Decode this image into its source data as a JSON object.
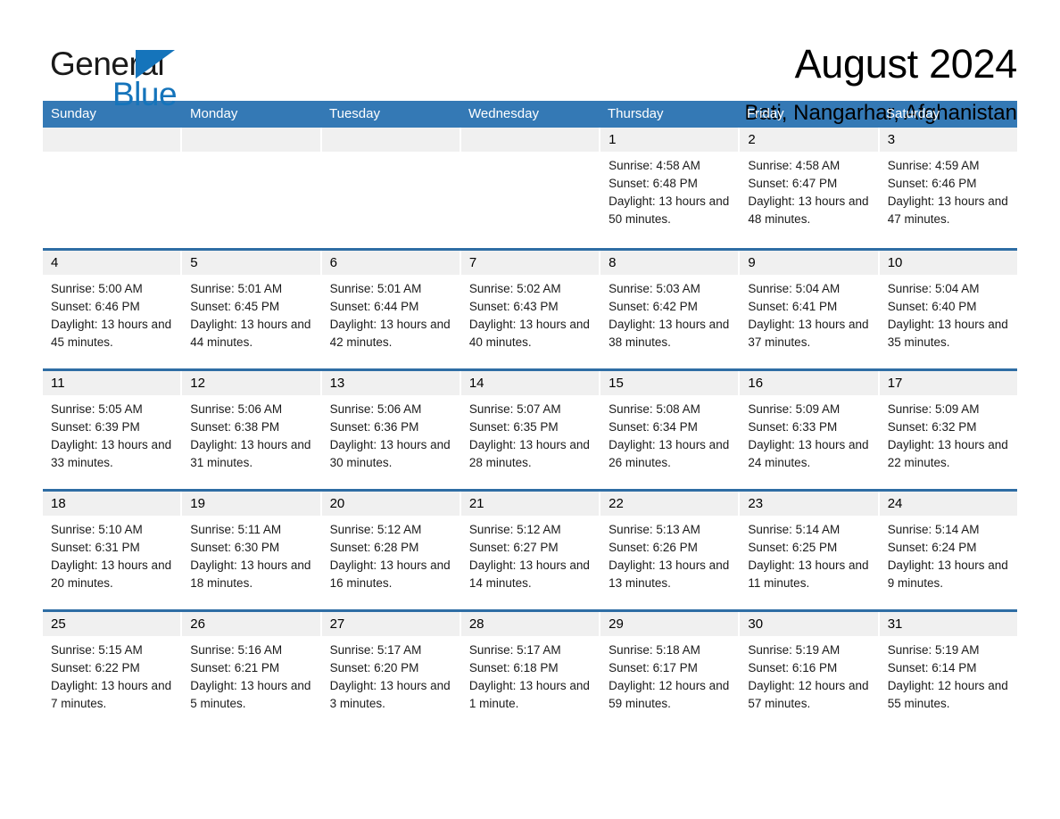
{
  "brand": {
    "name_top": "General",
    "name_bottom": "Blue",
    "triangle_color": "#1574bb"
  },
  "header": {
    "month_title": "August 2024",
    "location": "Bati, Nangarhar, Afghanistan"
  },
  "theme": {
    "header_blue": "#3479b5",
    "row_divider_blue": "#2e6da4",
    "day_number_band": "#f0f0f0"
  },
  "weekdays": [
    "Sunday",
    "Monday",
    "Tuesday",
    "Wednesday",
    "Thursday",
    "Friday",
    "Saturday"
  ],
  "weeks": [
    [
      {
        "day": "",
        "empty": true
      },
      {
        "day": "",
        "empty": true
      },
      {
        "day": "",
        "empty": true
      },
      {
        "day": "",
        "empty": true
      },
      {
        "day": "1",
        "sunrise": "Sunrise: 4:58 AM",
        "sunset": "Sunset: 6:48 PM",
        "daylight": "Daylight: 13 hours and 50 minutes."
      },
      {
        "day": "2",
        "sunrise": "Sunrise: 4:58 AM",
        "sunset": "Sunset: 6:47 PM",
        "daylight": "Daylight: 13 hours and 48 minutes."
      },
      {
        "day": "3",
        "sunrise": "Sunrise: 4:59 AM",
        "sunset": "Sunset: 6:46 PM",
        "daylight": "Daylight: 13 hours and 47 minutes."
      }
    ],
    [
      {
        "day": "4",
        "sunrise": "Sunrise: 5:00 AM",
        "sunset": "Sunset: 6:46 PM",
        "daylight": "Daylight: 13 hours and 45 minutes."
      },
      {
        "day": "5",
        "sunrise": "Sunrise: 5:01 AM",
        "sunset": "Sunset: 6:45 PM",
        "daylight": "Daylight: 13 hours and 44 minutes."
      },
      {
        "day": "6",
        "sunrise": "Sunrise: 5:01 AM",
        "sunset": "Sunset: 6:44 PM",
        "daylight": "Daylight: 13 hours and 42 minutes."
      },
      {
        "day": "7",
        "sunrise": "Sunrise: 5:02 AM",
        "sunset": "Sunset: 6:43 PM",
        "daylight": "Daylight: 13 hours and 40 minutes."
      },
      {
        "day": "8",
        "sunrise": "Sunrise: 5:03 AM",
        "sunset": "Sunset: 6:42 PM",
        "daylight": "Daylight: 13 hours and 38 minutes."
      },
      {
        "day": "9",
        "sunrise": "Sunrise: 5:04 AM",
        "sunset": "Sunset: 6:41 PM",
        "daylight": "Daylight: 13 hours and 37 minutes."
      },
      {
        "day": "10",
        "sunrise": "Sunrise: 5:04 AM",
        "sunset": "Sunset: 6:40 PM",
        "daylight": "Daylight: 13 hours and 35 minutes."
      }
    ],
    [
      {
        "day": "11",
        "sunrise": "Sunrise: 5:05 AM",
        "sunset": "Sunset: 6:39 PM",
        "daylight": "Daylight: 13 hours and 33 minutes."
      },
      {
        "day": "12",
        "sunrise": "Sunrise: 5:06 AM",
        "sunset": "Sunset: 6:38 PM",
        "daylight": "Daylight: 13 hours and 31 minutes."
      },
      {
        "day": "13",
        "sunrise": "Sunrise: 5:06 AM",
        "sunset": "Sunset: 6:36 PM",
        "daylight": "Daylight: 13 hours and 30 minutes."
      },
      {
        "day": "14",
        "sunrise": "Sunrise: 5:07 AM",
        "sunset": "Sunset: 6:35 PM",
        "daylight": "Daylight: 13 hours and 28 minutes."
      },
      {
        "day": "15",
        "sunrise": "Sunrise: 5:08 AM",
        "sunset": "Sunset: 6:34 PM",
        "daylight": "Daylight: 13 hours and 26 minutes."
      },
      {
        "day": "16",
        "sunrise": "Sunrise: 5:09 AM",
        "sunset": "Sunset: 6:33 PM",
        "daylight": "Daylight: 13 hours and 24 minutes."
      },
      {
        "day": "17",
        "sunrise": "Sunrise: 5:09 AM",
        "sunset": "Sunset: 6:32 PM",
        "daylight": "Daylight: 13 hours and 22 minutes."
      }
    ],
    [
      {
        "day": "18",
        "sunrise": "Sunrise: 5:10 AM",
        "sunset": "Sunset: 6:31 PM",
        "daylight": "Daylight: 13 hours and 20 minutes."
      },
      {
        "day": "19",
        "sunrise": "Sunrise: 5:11 AM",
        "sunset": "Sunset: 6:30 PM",
        "daylight": "Daylight: 13 hours and 18 minutes."
      },
      {
        "day": "20",
        "sunrise": "Sunrise: 5:12 AM",
        "sunset": "Sunset: 6:28 PM",
        "daylight": "Daylight: 13 hours and 16 minutes."
      },
      {
        "day": "21",
        "sunrise": "Sunrise: 5:12 AM",
        "sunset": "Sunset: 6:27 PM",
        "daylight": "Daylight: 13 hours and 14 minutes."
      },
      {
        "day": "22",
        "sunrise": "Sunrise: 5:13 AM",
        "sunset": "Sunset: 6:26 PM",
        "daylight": "Daylight: 13 hours and 13 minutes."
      },
      {
        "day": "23",
        "sunrise": "Sunrise: 5:14 AM",
        "sunset": "Sunset: 6:25 PM",
        "daylight": "Daylight: 13 hours and 11 minutes."
      },
      {
        "day": "24",
        "sunrise": "Sunrise: 5:14 AM",
        "sunset": "Sunset: 6:24 PM",
        "daylight": "Daylight: 13 hours and 9 minutes."
      }
    ],
    [
      {
        "day": "25",
        "sunrise": "Sunrise: 5:15 AM",
        "sunset": "Sunset: 6:22 PM",
        "daylight": "Daylight: 13 hours and 7 minutes."
      },
      {
        "day": "26",
        "sunrise": "Sunrise: 5:16 AM",
        "sunset": "Sunset: 6:21 PM",
        "daylight": "Daylight: 13 hours and 5 minutes."
      },
      {
        "day": "27",
        "sunrise": "Sunrise: 5:17 AM",
        "sunset": "Sunset: 6:20 PM",
        "daylight": "Daylight: 13 hours and 3 minutes."
      },
      {
        "day": "28",
        "sunrise": "Sunrise: 5:17 AM",
        "sunset": "Sunset: 6:18 PM",
        "daylight": "Daylight: 13 hours and 1 minute."
      },
      {
        "day": "29",
        "sunrise": "Sunrise: 5:18 AM",
        "sunset": "Sunset: 6:17 PM",
        "daylight": "Daylight: 12 hours and 59 minutes."
      },
      {
        "day": "30",
        "sunrise": "Sunrise: 5:19 AM",
        "sunset": "Sunset: 6:16 PM",
        "daylight": "Daylight: 12 hours and 57 minutes."
      },
      {
        "day": "31",
        "sunrise": "Sunrise: 5:19 AM",
        "sunset": "Sunset: 6:14 PM",
        "daylight": "Daylight: 12 hours and 55 minutes."
      }
    ]
  ]
}
